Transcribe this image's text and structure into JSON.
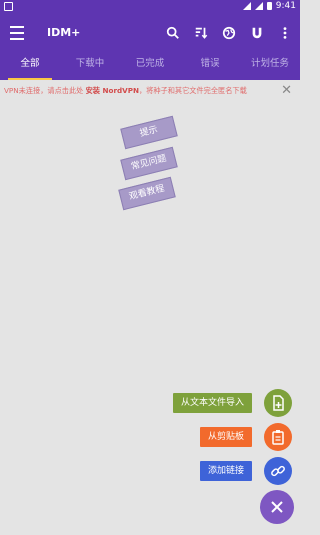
{
  "status_bar": {
    "time": "9:41"
  },
  "app": {
    "title": "IDM+"
  },
  "tabs": [
    {
      "label": "全部",
      "active": true
    },
    {
      "label": "下载中",
      "active": false
    },
    {
      "label": "已完成",
      "active": false
    },
    {
      "label": "错误",
      "active": false
    },
    {
      "label": "计划任务",
      "active": false
    }
  ],
  "notice": {
    "text_before": "VPN未连接，请点击此处 ",
    "link": "安装 NordVPN",
    "text_after": "，将种子和其它文件完全匿名下载"
  },
  "hints": [
    "提示",
    "常见问题",
    "观看教程"
  ],
  "actions": {
    "import_file": "从文本文件导入",
    "clipboard": "从剪贴板",
    "add_link": "添加链接"
  },
  "colors": {
    "primary": "#5e35b1",
    "tab_indicator": "#f9c846",
    "import_color": "#7ea13b",
    "clipboard_color": "#f26a2c",
    "link_color": "#3e63d8",
    "fab_main": "#7e57c2"
  }
}
